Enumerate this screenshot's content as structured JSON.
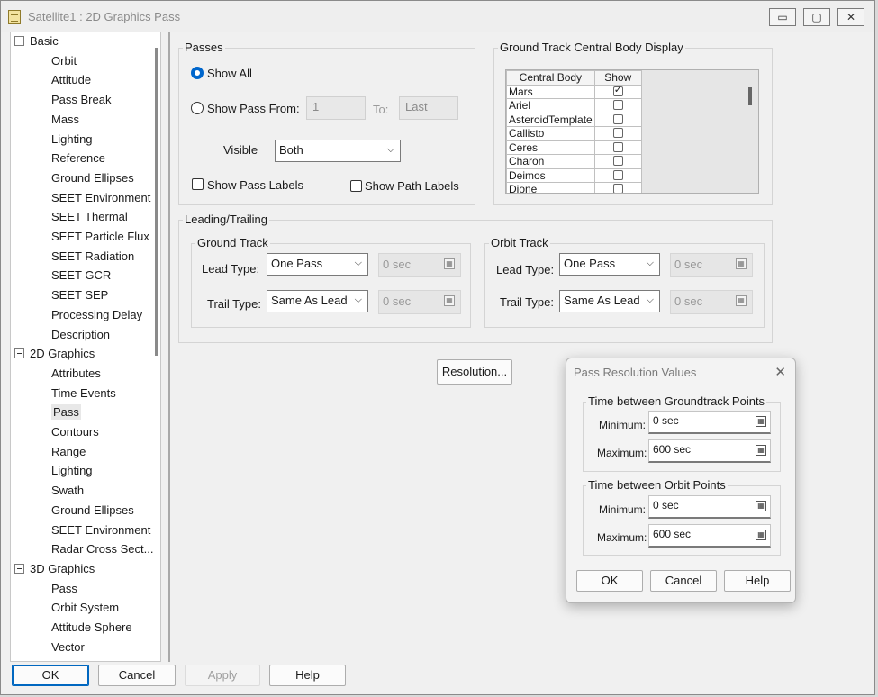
{
  "window": {
    "title": "Satellite1 : 2D Graphics Pass",
    "controls": {
      "minimize": "▭",
      "maximize": "▢",
      "close": "✕"
    }
  },
  "tree": {
    "groups": [
      {
        "label": "Basic",
        "children": [
          "Orbit",
          "Attitude",
          "Pass Break",
          "Mass",
          "Lighting",
          "Reference",
          "Ground Ellipses",
          "SEET Environment",
          "SEET Thermal",
          "SEET Particle Flux",
          "SEET Radiation",
          "SEET GCR",
          "SEET SEP",
          "Processing Delay",
          "Description"
        ]
      },
      {
        "label": "2D Graphics",
        "children": [
          "Attributes",
          "Time Events",
          "Pass",
          "Contours",
          "Range",
          "Lighting",
          "Swath",
          "Ground Ellipses",
          "SEET Environment",
          "Radar Cross Sect..."
        ]
      },
      {
        "label": "3D Graphics",
        "children": [
          "Pass",
          "Orbit System",
          "Attitude Sphere",
          "Vector"
        ]
      }
    ],
    "selected": "Pass"
  },
  "passes": {
    "title": "Passes",
    "show_all_label": "Show All",
    "show_pass_from_label": "Show Pass From:",
    "from_value": "1",
    "to_label": "To:",
    "to_value": "Last",
    "visible_label": "Visible",
    "visible_value": "Both",
    "show_pass_labels": "Show Pass Labels",
    "show_path_labels": "Show Path Labels",
    "selected_mode": "Show All"
  },
  "central_body": {
    "title": "Ground Track Central Body Display",
    "col_name": "Central Body",
    "col_show": "Show",
    "rows": [
      {
        "name": "Mars",
        "show": true
      },
      {
        "name": "Ariel",
        "show": false
      },
      {
        "name": "AsteroidTemplate",
        "show": false
      },
      {
        "name": "Callisto",
        "show": false
      },
      {
        "name": "Ceres",
        "show": false
      },
      {
        "name": "Charon",
        "show": false
      },
      {
        "name": "Deimos",
        "show": false
      },
      {
        "name": "Dione",
        "show": false
      }
    ]
  },
  "leading_trailing": {
    "title": "Leading/Trailing",
    "ground_track": {
      "title": "Ground Track",
      "lead_label": "Lead Type:",
      "lead_value": "One Pass",
      "lead_time": "0 sec",
      "trail_label": "Trail Type:",
      "trail_value": "Same As Lead",
      "trail_time": "0 sec"
    },
    "orbit_track": {
      "title": "Orbit Track",
      "lead_label": "Lead Type:",
      "lead_value": "One Pass",
      "lead_time": "0 sec",
      "trail_label": "Trail Type:",
      "trail_value": "Same As Lead",
      "trail_time": "0 sec"
    }
  },
  "resolution_button": "Resolution...",
  "dialog": {
    "title": "Pass Resolution Values",
    "close": "✕",
    "groundtrack": {
      "title": "Time between Groundtrack Points",
      "min_label": "Minimum:",
      "min_value": "0 sec",
      "max_label": "Maximum:",
      "max_value": "600 sec"
    },
    "orbit": {
      "title": "Time between Orbit Points",
      "min_label": "Minimum:",
      "min_value": "0 sec",
      "max_label": "Maximum:",
      "max_value": "600 sec"
    },
    "ok": "OK",
    "cancel": "Cancel",
    "help": "Help"
  },
  "footer": {
    "ok": "OK",
    "cancel": "Cancel",
    "apply": "Apply",
    "help": "Help"
  },
  "colors": {
    "accent": "#0067c0",
    "radio": "#0066cc"
  },
  "icons": {
    "spin": "calculator-icon",
    "dropdown": "chevron-down-icon"
  }
}
